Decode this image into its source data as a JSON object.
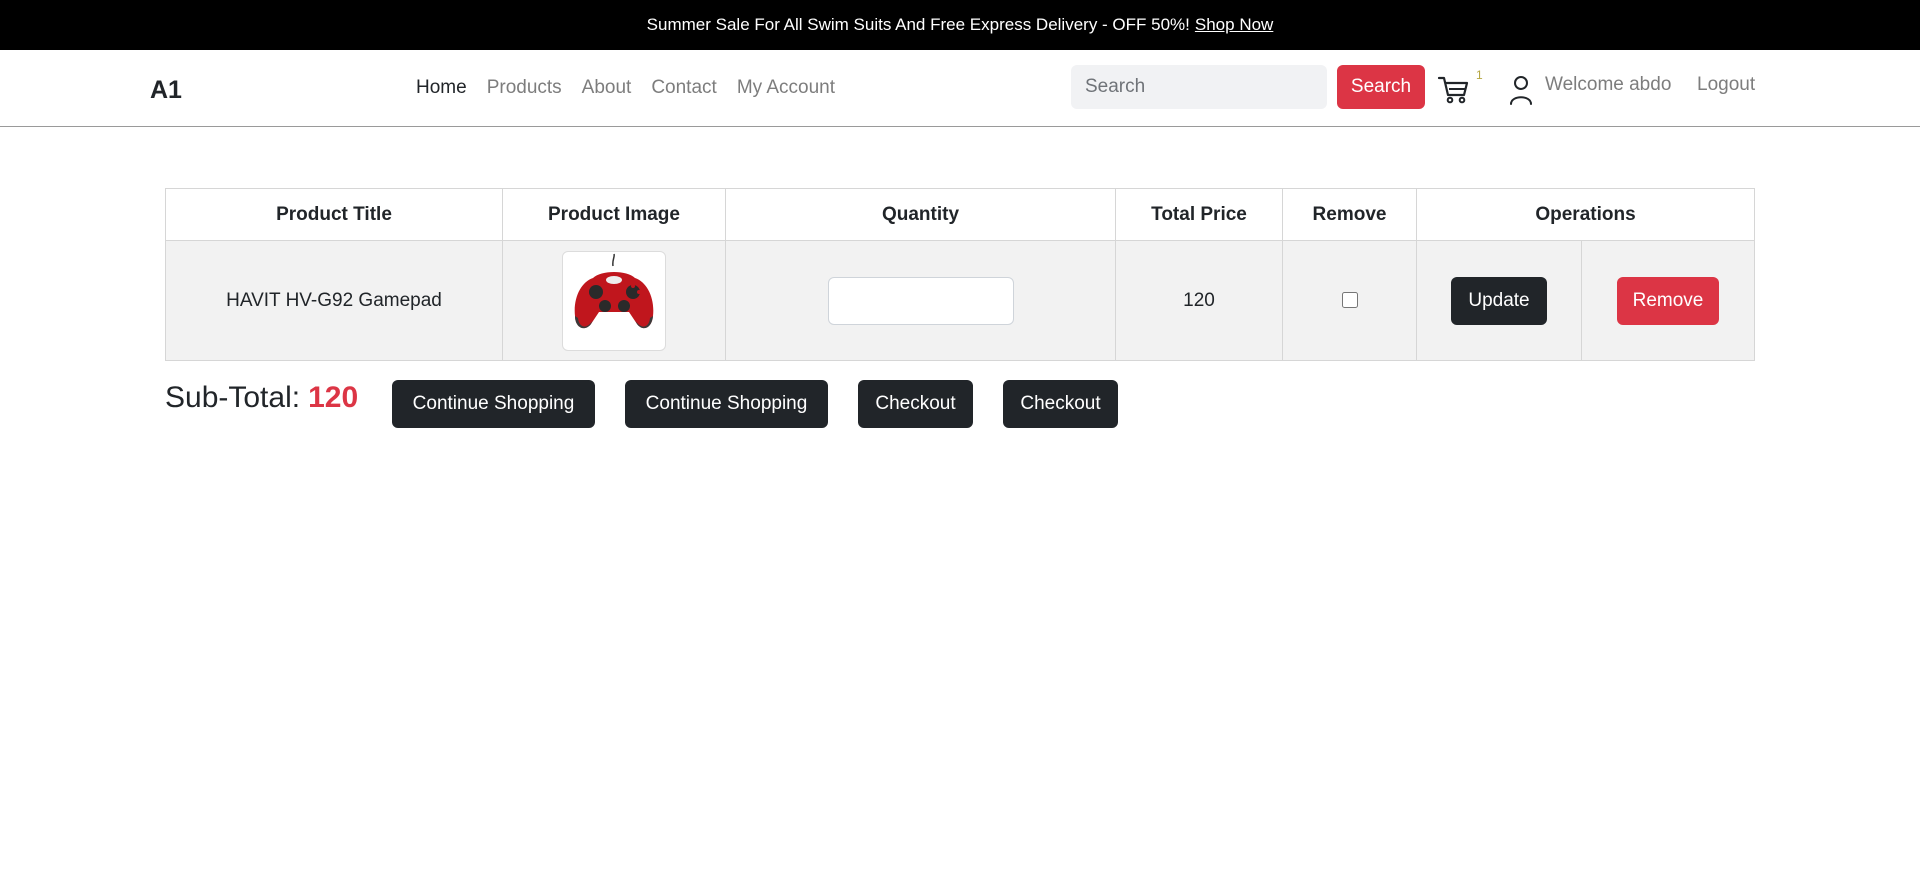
{
  "promo": {
    "text": "Summer Sale For All Swim Suits And Free Express Delivery - OFF 50%!",
    "link": "Shop Now"
  },
  "nav": {
    "brand": "A1",
    "menu": [
      "Home",
      "Products",
      "About",
      "Contact",
      "My Account"
    ],
    "active": "Home",
    "search_placeholder": "Search",
    "search_button": "Search",
    "cart_count": "1",
    "welcome": "Welcome abdo",
    "logout": "Logout"
  },
  "table": {
    "headers": [
      "Product Title",
      "Product Image",
      "Quantity",
      "Total Price",
      "Remove",
      "Operations"
    ],
    "rows": [
      {
        "title": "HAVIT HV-G92 Gamepad",
        "image": "gamepad-image",
        "quantity": "",
        "total_price": "120",
        "remove_checked": false,
        "update_label": "Update",
        "remove_label": "Remove"
      }
    ]
  },
  "summary": {
    "label": "Sub-Total:",
    "amount": "120",
    "buttons": [
      "Continue Shopping",
      "Continue Shopping",
      "Checkout",
      "Checkout"
    ]
  },
  "colors": {
    "accent": "#dc3545",
    "dark": "#212529",
    "promo_bg": "#000000"
  }
}
